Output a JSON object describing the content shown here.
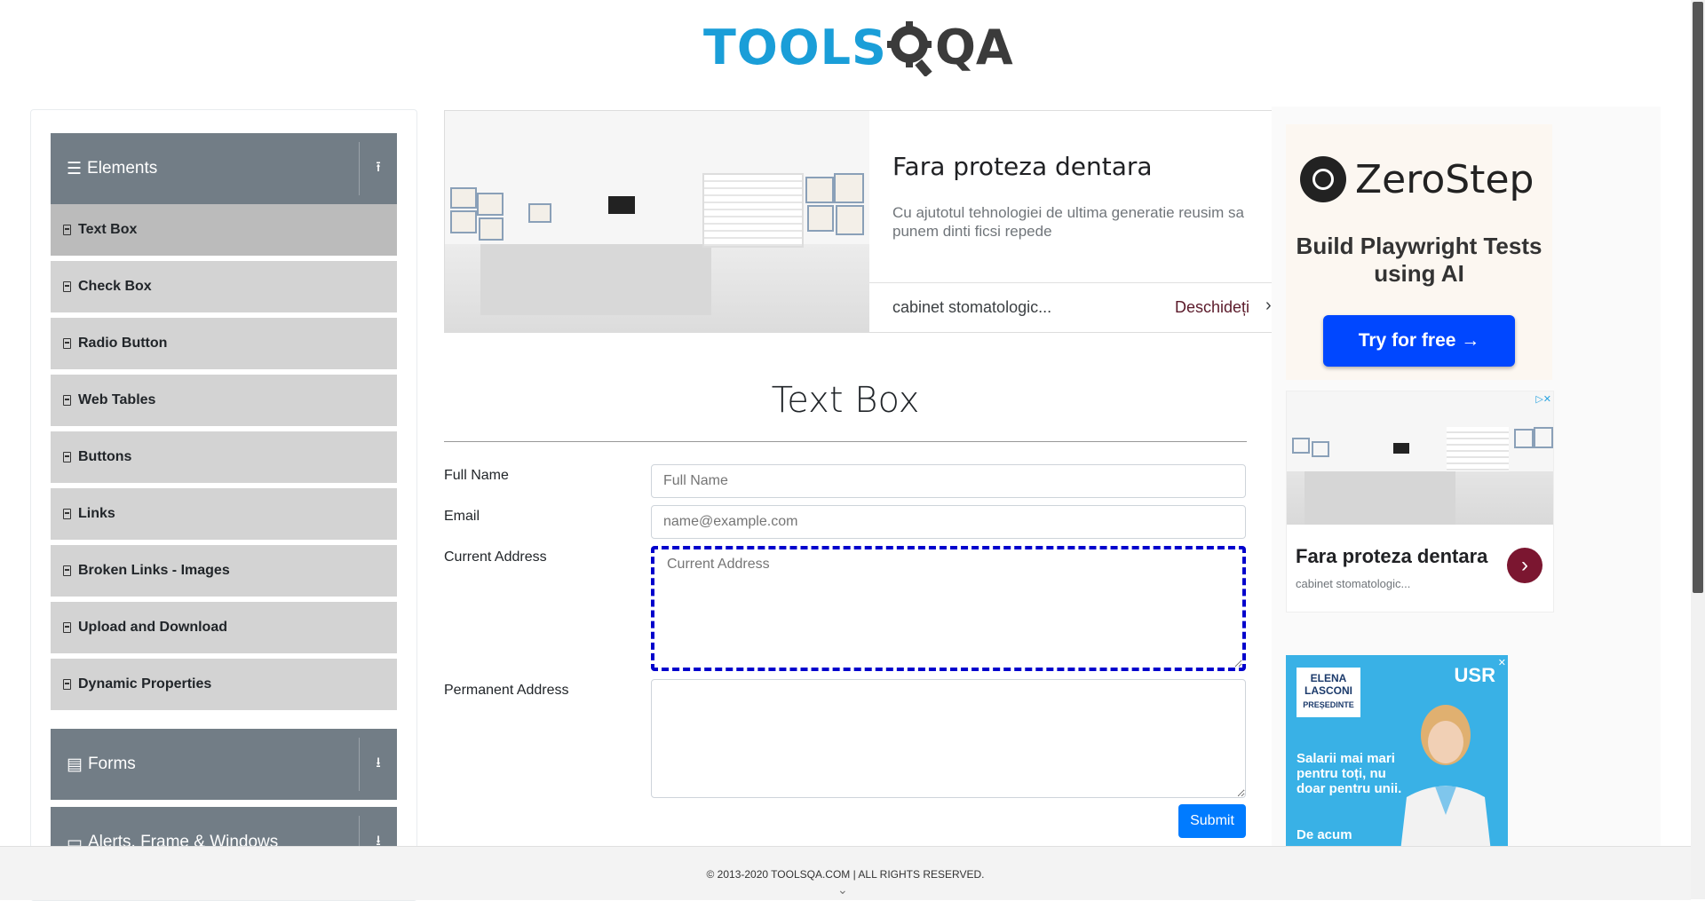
{
  "header": {
    "logo_tools": "TOOLS",
    "logo_qa": "QA"
  },
  "sidebar": {
    "groups": [
      {
        "label": "Elements",
        "icon": "hamburger-icon",
        "arrow": "⭱"
      },
      {
        "label": "Forms",
        "icon": "document-icon",
        "arrow": "⭳"
      },
      {
        "label": "Alerts, Frame & Windows",
        "icon": "window-icon",
        "arrow": "⭳"
      }
    ],
    "items": [
      {
        "label": "Text Box",
        "active": true
      },
      {
        "label": "Check Box"
      },
      {
        "label": "Radio Button"
      },
      {
        "label": "Web Tables"
      },
      {
        "label": "Buttons"
      },
      {
        "label": "Links"
      },
      {
        "label": "Broken Links - Images"
      },
      {
        "label": "Upload and Download"
      },
      {
        "label": "Dynamic Properties"
      }
    ]
  },
  "top_ad": {
    "title": "Fara proteza dentara",
    "description": "Cu ajutotul tehnologiei de ultima generatie reusim sa punem dinti ficsi repede",
    "domain": "cabinet stomatologic...",
    "open_label": "Deschideți",
    "chevron": "›"
  },
  "form": {
    "title": "Text Box",
    "full_name_label": "Full Name",
    "full_name_placeholder": "Full Name",
    "email_label": "Email",
    "email_placeholder": "name@example.com",
    "current_address_label": "Current Address",
    "current_address_placeholder": "Current Address",
    "permanent_address_label": "Permanent Address",
    "submit_label": "Submit"
  },
  "right_ads": {
    "zerostep_name": "ZeroStep",
    "zerostep_headline": "Build Playwright Tests using AI",
    "zerostep_cta": "Try for free →",
    "dental_title": "Fara proteza dentara",
    "dental_domain": "cabinet stomatologic...",
    "dental_go": "›",
    "usr_name_line1": "ELENA",
    "usr_name_line2": "LASCONI",
    "usr_name_sub": "PREȘEDINTE",
    "usr_logo": "USR",
    "usr_text": "Salarii mai mari pentru toți, nu doar pentru unii.",
    "usr_text2": "De acum"
  },
  "footer": {
    "copyright": "© 2013-2020 TOOLSQA.COM | ALL RIGHTS RESERVED.",
    "chevron": "⌄"
  },
  "colors": {
    "brand_blue": "#1a9ed8",
    "group_header": "#727d86",
    "menu_item": "#d3d3d3",
    "submit": "#007bff",
    "focus_outline": "#0000cc"
  }
}
